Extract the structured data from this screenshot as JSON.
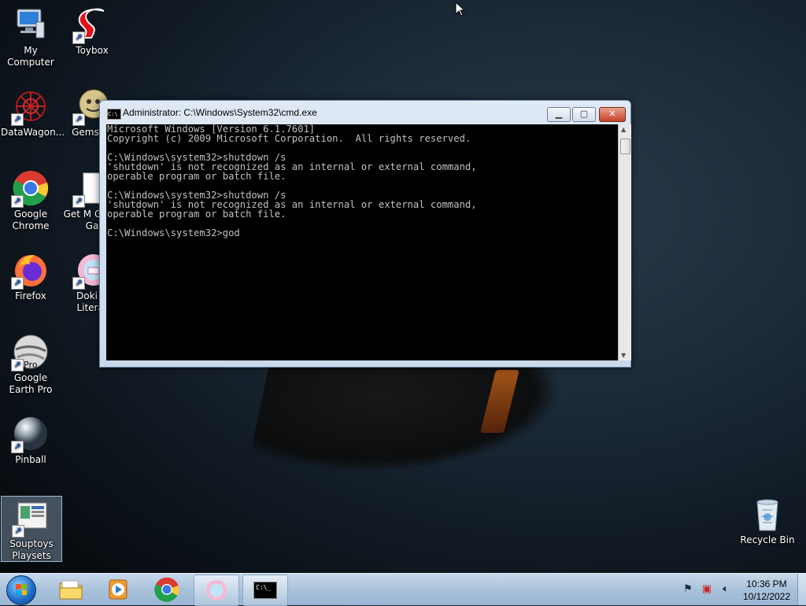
{
  "desktop": {
    "icons": [
      {
        "label": "My Computer",
        "icon": "computer-icon"
      },
      {
        "label": "Toybox",
        "icon": "toybox-icon"
      },
      {
        "label": "DataWagon...",
        "icon": "datawagon-icon"
      },
      {
        "label": "Gemswe",
        "icon": "gemswe-icon"
      },
      {
        "label": "Google Chrome",
        "icon": "chrome-icon"
      },
      {
        "label": "Get M Great Ga",
        "icon": "document-icon"
      },
      {
        "label": "Firefox",
        "icon": "firefox-icon"
      },
      {
        "label": "Doki D Literat",
        "icon": "doki-doki-icon"
      },
      {
        "label": "Google Earth Pro",
        "icon": "google-earth-icon"
      },
      {
        "label": "Pinball",
        "icon": "pinball-icon"
      },
      {
        "label": "Souptoys Playsets",
        "icon": "souptoys-icon"
      },
      {
        "label": "Recycle Bin",
        "icon": "recycle-bin-icon"
      }
    ],
    "earth_badge": "Pro"
  },
  "cmd": {
    "title": "Administrator: C:\\Windows\\System32\\cmd.exe",
    "icon_text": "C:\\",
    "lines": [
      "Microsoft Windows [Version 6.1.7601]",
      "Copyright (c) 2009 Microsoft Corporation.  All rights reserved.",
      "",
      "C:\\Windows\\system32>shutdown /s",
      "'shutdown' is not recognized as an internal or external command,",
      "operable program or batch file.",
      "",
      "C:\\Windows\\system32>shutdown /s",
      "'shutdown' is not recognized as an internal or external command,",
      "operable program or batch file.",
      "",
      "C:\\Windows\\system32>god"
    ]
  },
  "taskbar": {
    "items": [
      {
        "name": "explorer",
        "icon": "folder-icon"
      },
      {
        "name": "media-player",
        "icon": "media-player-icon"
      },
      {
        "name": "chrome",
        "icon": "chrome-icon"
      },
      {
        "name": "doki-doki",
        "icon": "doki-doki-icon"
      },
      {
        "name": "cmd",
        "icon": "cmd-icon",
        "active": true
      }
    ],
    "cmd_icon_text": "C:\\_",
    "clock_time": "10:36 PM",
    "clock_date": "10/12/2022"
  },
  "colors": {
    "cmd_text": "#c0c0c0",
    "cmd_bg": "#000000",
    "taskbar": "#a9c2dc"
  }
}
